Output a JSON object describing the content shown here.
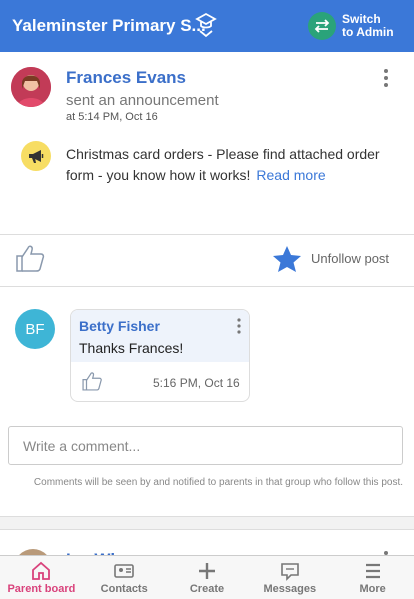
{
  "header": {
    "school_name": "Yaleminster Primary S...",
    "switch_label_line1": "Switch",
    "switch_label_line2": "to Admin"
  },
  "post": {
    "author": "Frances Evans",
    "action": "sent an announcement",
    "time": "at  5:14 PM, Oct 16",
    "body": "Christmas card orders  -  Please find attached order form - you know how it works!",
    "read_more": "Read more",
    "unfollow_label": "Unfollow post"
  },
  "comment": {
    "avatar_initials": "BF",
    "author": "Betty Fisher",
    "text": "Thanks Frances!",
    "time": "5:16 PM, Oct 16"
  },
  "comment_input": {
    "placeholder": "Write a comment...",
    "note": "Comments will be seen by and notified to parents in that group who follow this post."
  },
  "next_post": {
    "author_partial": "Ivy Wh..."
  },
  "bottom_nav": {
    "items": [
      {
        "label": "Parent board",
        "icon": "home-icon",
        "active": true
      },
      {
        "label": "Contacts",
        "icon": "contact-card-icon",
        "active": false
      },
      {
        "label": "Create",
        "icon": "plus-icon",
        "active": false
      },
      {
        "label": "Messages",
        "icon": "message-icon",
        "active": false
      },
      {
        "label": "More",
        "icon": "menu-icon",
        "active": false
      }
    ]
  },
  "colors": {
    "header_blue": "#3b78d8",
    "link_blue": "#3b6fc9",
    "switch_green": "#2aa37a",
    "active_pink": "#d9437c",
    "announce_yellow": "#f7dd63",
    "avatar_teal": "#3eb5d6"
  }
}
